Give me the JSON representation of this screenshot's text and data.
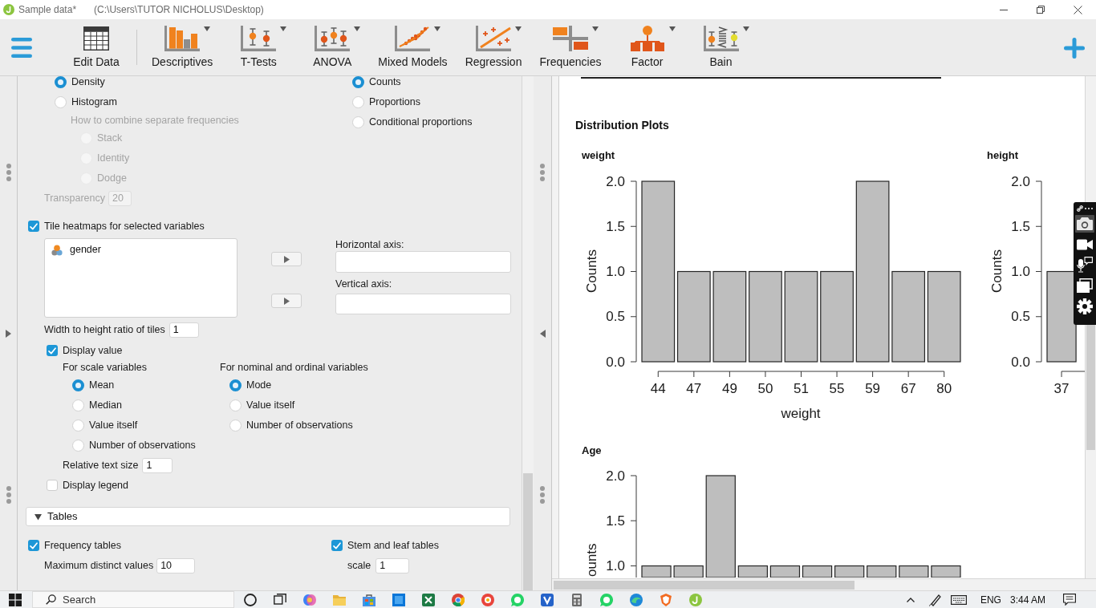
{
  "window": {
    "title": "Sample data*",
    "path": "(C:\\Users\\TUTOR NICHOLUS\\Desktop)"
  },
  "toolbar": [
    {
      "label": "Edit Data",
      "kind": "table",
      "dropdown": false
    },
    {
      "label": "Descriptives",
      "kind": "bars",
      "dropdown": true
    },
    {
      "label": "T-Tests",
      "kind": "ttest",
      "dropdown": true
    },
    {
      "label": "ANOVA",
      "kind": "anova",
      "dropdown": true
    },
    {
      "label": "Mixed Models",
      "kind": "mixed",
      "dropdown": true
    },
    {
      "label": "Regression",
      "kind": "regression",
      "dropdown": true
    },
    {
      "label": "Frequencies",
      "kind": "frequencies",
      "dropdown": true
    },
    {
      "label": "Factor",
      "kind": "factor",
      "dropdown": true
    },
    {
      "label": "Bain",
      "kind": "bain",
      "dropdown": true
    }
  ],
  "options": {
    "plot_type": [
      {
        "label": "Density",
        "selected": true
      },
      {
        "label": "Histogram",
        "selected": false
      }
    ],
    "combine": {
      "label": "How to combine separate frequencies",
      "disabled": true,
      "options": [
        {
          "label": "Stack",
          "selected": false
        },
        {
          "label": "Identity",
          "selected": false
        },
        {
          "label": "Dodge",
          "selected": false
        }
      ]
    },
    "transparency": {
      "label": "Transparency",
      "value": "20",
      "disabled": true
    },
    "frequency_scale": [
      {
        "label": "Counts",
        "selected": true
      },
      {
        "label": "Proportions",
        "selected": false
      },
      {
        "label": "Conditional proportions",
        "selected": false
      }
    ],
    "tile_heatmaps": {
      "label": "Tile heatmaps for selected variables",
      "checked": true
    },
    "variables": [
      {
        "name": "gender"
      }
    ],
    "horizontal_axis": {
      "label": "Horizontal axis:"
    },
    "vertical_axis": {
      "label": "Vertical axis:"
    },
    "tile_ratio": {
      "label": "Width to height ratio of tiles",
      "value": "1"
    },
    "display_value": {
      "label": "Display value",
      "checked": true
    },
    "scale_variables": {
      "label": "For scale variables",
      "options": [
        {
          "label": "Mean",
          "selected": true
        },
        {
          "label": "Median",
          "selected": false
        },
        {
          "label": "Value itself",
          "selected": false
        },
        {
          "label": "Number of observations",
          "selected": false
        }
      ]
    },
    "nominal_variables": {
      "label": "For nominal and ordinal variables",
      "options": [
        {
          "label": "Mode",
          "selected": true
        },
        {
          "label": "Value itself",
          "selected": false
        },
        {
          "label": "Number of observations",
          "selected": false
        }
      ]
    },
    "relative_text_size": {
      "label": "Relative text size",
      "value": "1"
    },
    "display_legend": {
      "label": "Display legend",
      "checked": false
    },
    "tables": {
      "label": "Tables",
      "expanded": true,
      "frequency_tables": {
        "label": "Frequency tables",
        "checked": true
      },
      "max_distinct": {
        "label": "Maximum distinct values",
        "value": "10"
      },
      "stem_and_leaf": {
        "label": "Stem and leaf tables",
        "checked": true
      },
      "stem_scale": {
        "label": "scale",
        "value": "1"
      }
    }
  },
  "output": {
    "heading": "Distribution Plots",
    "plots": [
      {
        "kind": "chart",
        "chart_data": {
          "type": "bar",
          "title": "weight",
          "xlabel": "weight",
          "ylabel": "Counts",
          "categories": [
            "44",
            "47",
            "49",
            "50",
            "51",
            "55",
            "59",
            "67",
            "80"
          ],
          "values": [
            2,
            1,
            1,
            1,
            1,
            1,
            2,
            1,
            1
          ],
          "ylim": [
            0,
            2
          ],
          "yticks": [
            {
              "value": 0,
              "label": "0.0"
            },
            {
              "value": 0.5,
              "label": "0.5"
            },
            {
              "value": 1,
              "label": "1.0"
            },
            {
              "value": 1.5,
              "label": "1.5"
            },
            {
              "value": 2,
              "label": "2.0"
            }
          ]
        }
      },
      {
        "kind": "chart",
        "chart_data": {
          "type": "bar",
          "title": "height",
          "ylabel": "Counts",
          "categories": [
            "37"
          ],
          "values": [
            1
          ],
          "ylim": [
            0,
            2
          ],
          "yticks": [
            {
              "value": 0,
              "label": "0.0"
            },
            {
              "value": 0.5,
              "label": "0.5"
            },
            {
              "value": 1,
              "label": "1.0"
            },
            {
              "value": 1.5,
              "label": "1.5"
            },
            {
              "value": 2,
              "label": "2.0"
            }
          ]
        }
      },
      {
        "kind": "picture",
        "title": "Age",
        "ylabel": "ounts",
        "tick_labels": [
          "2.0",
          "1.5",
          "1.0"
        ]
      }
    ]
  },
  "taskbar": {
    "search": {
      "placeholder": "Search"
    },
    "language": "ENG",
    "time": "3:44 AM"
  }
}
